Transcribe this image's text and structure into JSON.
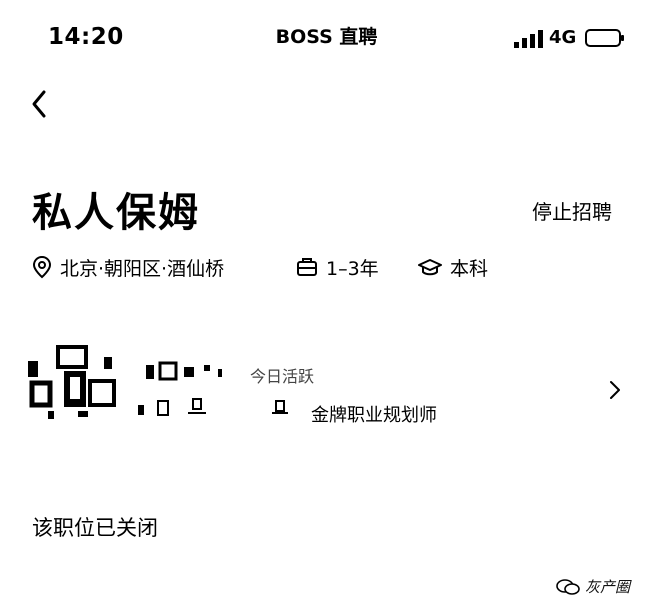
{
  "status_bar": {
    "time": "14:20",
    "app_name": "BOSS 直聘",
    "network": "4G",
    "icons": [
      "signal-icon",
      "battery-icon"
    ]
  },
  "nav": {
    "back_icon": "back-chevron-icon"
  },
  "job": {
    "title": "私人保姆",
    "stop_label": "停止招聘",
    "location": "北京·朝阳区·酒仙桥",
    "experience": "1–3年",
    "education": "本科",
    "icons": [
      "location-pin-icon",
      "briefcase-icon",
      "graduation-cap-icon"
    ]
  },
  "recruiter": {
    "active_status": "今日活跃",
    "title": "金牌职业规划师",
    "icons": [
      "avatar",
      "chevron-right-icon"
    ]
  },
  "notice": {
    "closed_text": "该职位已关闭"
  },
  "watermark": {
    "text": "灰产圈"
  }
}
